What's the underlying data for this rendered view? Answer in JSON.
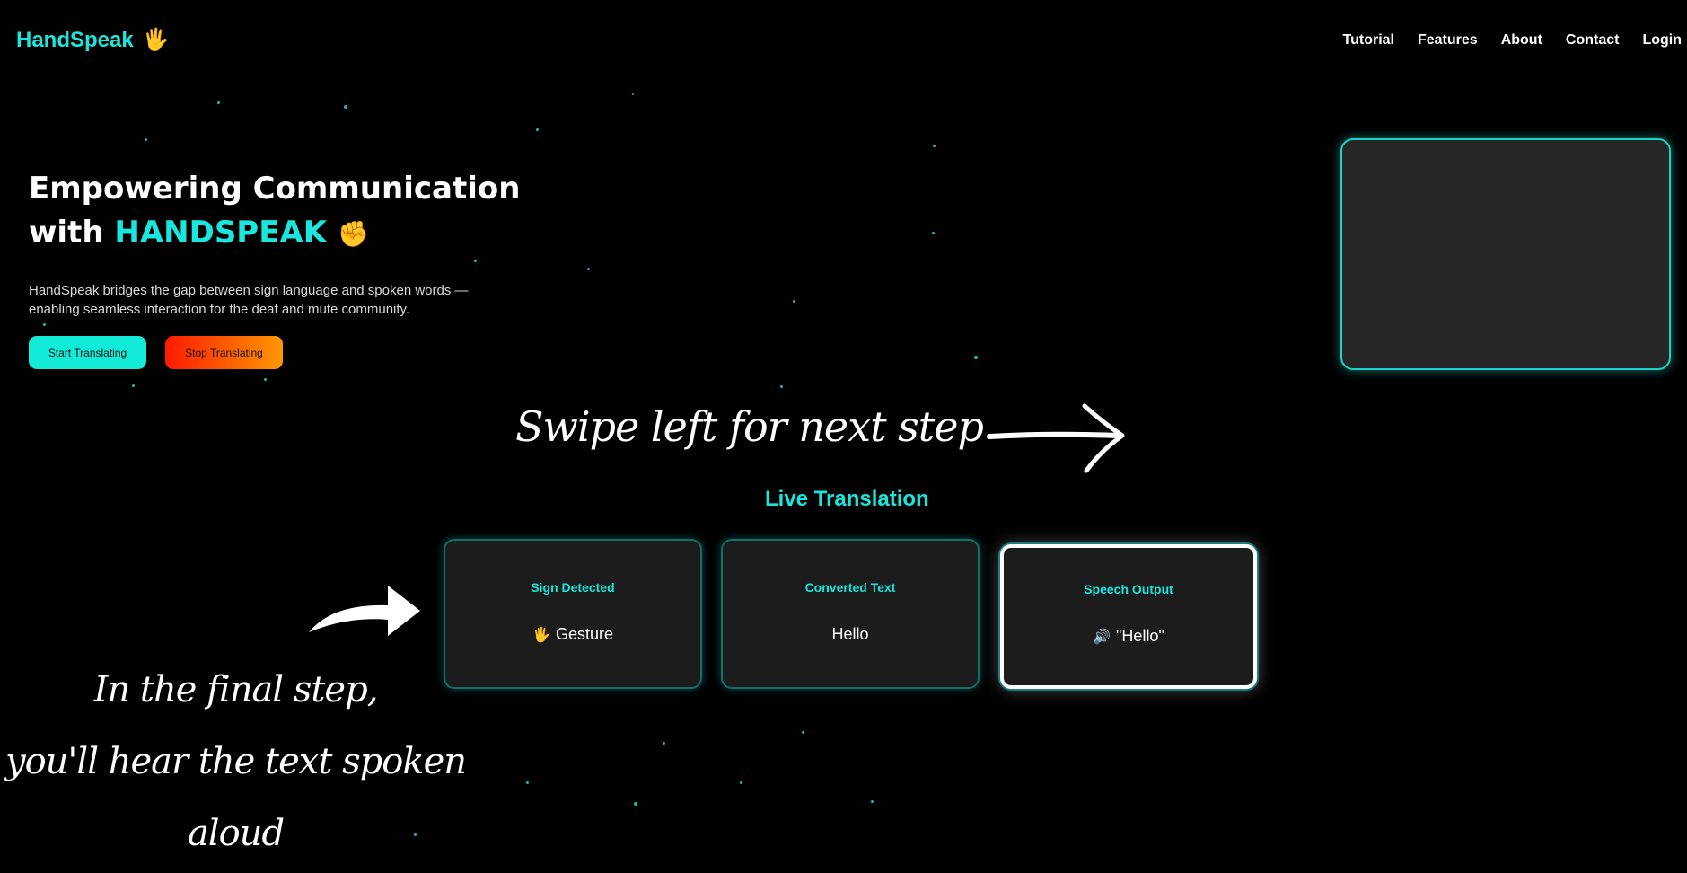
{
  "brand": {
    "name": "HandSpeak",
    "icon": "waving-hand-icon"
  },
  "nav": {
    "items": [
      "Tutorial",
      "Features",
      "About",
      "Contact",
      "Login"
    ]
  },
  "hero": {
    "title_line1": "Empowering Communication",
    "title_with": "with",
    "title_brand": "HANDSPEAK",
    "title_icon": "raised-fist-icon",
    "description": "HandSpeak bridges the gap between sign language and spoken words — enabling seamless interaction for the deaf and mute community.",
    "start_label": "Start Translating",
    "stop_label": "Stop Translating"
  },
  "annotations": {
    "swipe": "Swipe left for next step",
    "final_line1": "In the final step,",
    "final_line2": "you'll hear the text spoken aloud"
  },
  "live": {
    "heading": "Live Translation",
    "cards": [
      {
        "title": "Sign Detected",
        "icon": "waving-hand-icon",
        "value": "Gesture"
      },
      {
        "title": "Converted Text",
        "value": "Hello"
      },
      {
        "title": "Speech Output",
        "icon": "speaker-icon",
        "value": "\"Hello\""
      }
    ]
  },
  "colors": {
    "accent": "#19e6dc",
    "background": "#000000"
  }
}
